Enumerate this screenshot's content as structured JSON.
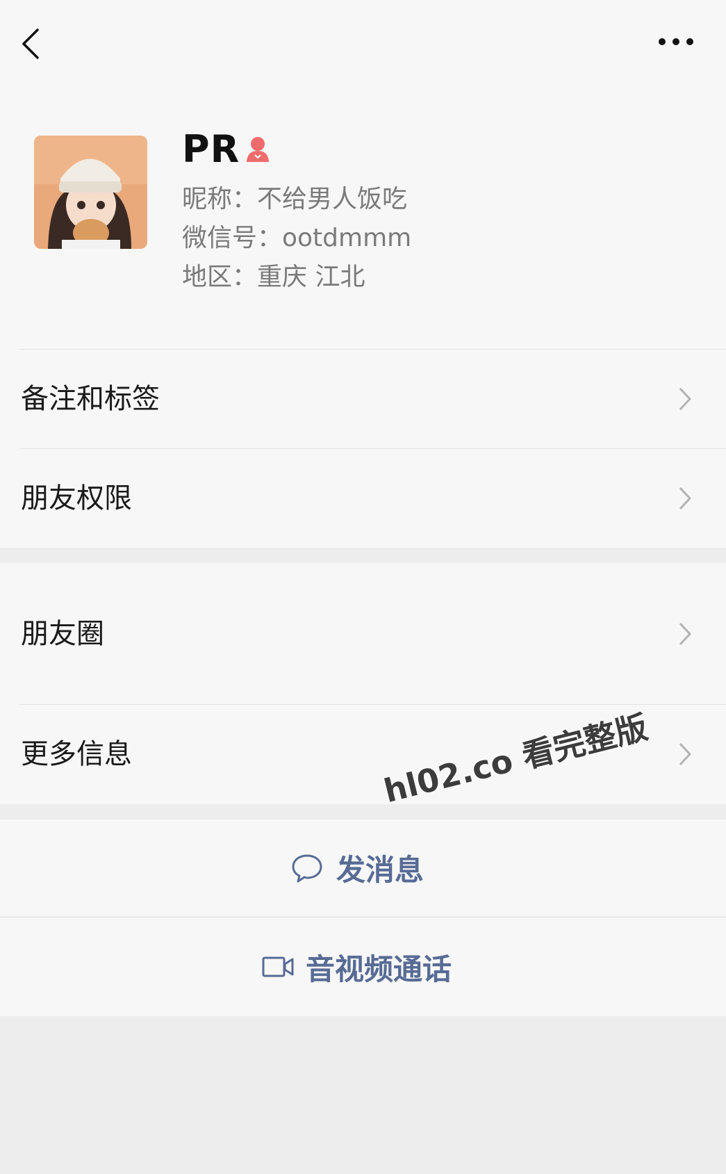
{
  "header": {
    "back_icon": "chevron-left-icon",
    "more_icon": "more-dots-icon"
  },
  "profile": {
    "name": "PR",
    "gender_icon": "female-icon",
    "nickname": "昵称：不给男人饭吃",
    "wechat_id": "微信号：ootdmmm",
    "region": "地区：重庆 江北"
  },
  "menu": {
    "remarks_tags": "备注和标签",
    "friend_permissions": "朋友权限",
    "moments": "朋友圈",
    "more_info": "更多信息"
  },
  "actions": {
    "send_message": "发消息",
    "video_call": "音视频通话"
  },
  "watermark": "hl02.co 看完整版",
  "colors": {
    "link": "#576b95",
    "background": "#ededed",
    "panel": "#f7f7f7",
    "gender": "#f06b6b"
  }
}
